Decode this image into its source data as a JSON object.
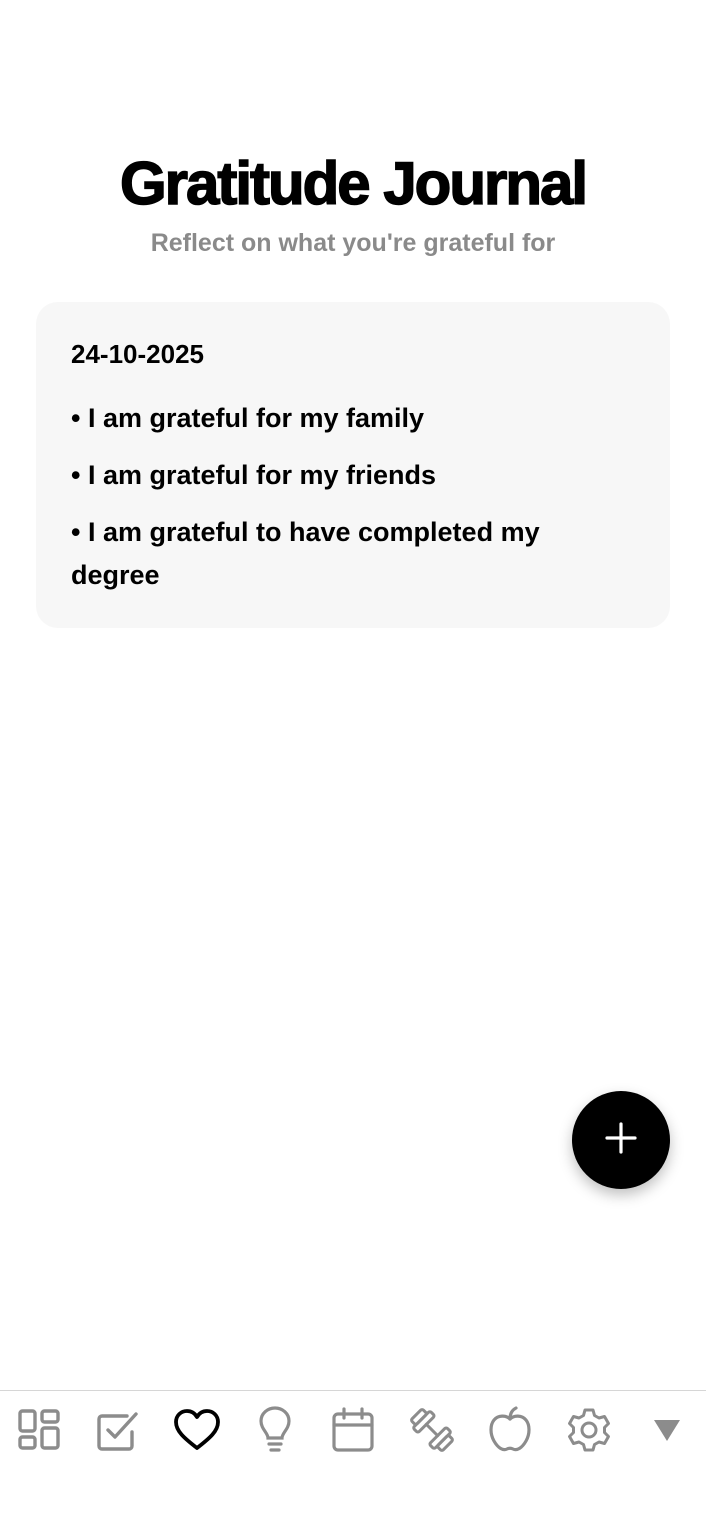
{
  "header": {
    "title": "Gratitude Journal",
    "subtitle": "Reflect on what you're grateful for"
  },
  "entries": [
    {
      "date": "24-10-2025",
      "items": [
        "I am grateful for my family",
        "I am grateful for my friends",
        "I am grateful to have completed my degree"
      ]
    }
  ],
  "fab": {
    "icon": "plus-icon"
  },
  "tabbar": {
    "active_tab": "gratitude",
    "tabs": [
      {
        "id": "dashboard",
        "icon": "dashboard-grid-icon",
        "active": false
      },
      {
        "id": "tasks",
        "icon": "checkbox-icon",
        "active": false
      },
      {
        "id": "gratitude",
        "icon": "heart-icon",
        "active": true
      },
      {
        "id": "ideas",
        "icon": "lightbulb-icon",
        "active": false
      },
      {
        "id": "calendar",
        "icon": "calendar-icon",
        "active": false
      },
      {
        "id": "fitness",
        "icon": "dumbbell-icon",
        "active": false
      },
      {
        "id": "nutrition",
        "icon": "apple-icon",
        "active": false
      },
      {
        "id": "settings",
        "icon": "gear-icon",
        "active": false
      },
      {
        "id": "more",
        "icon": "triangle-down-icon",
        "active": false
      }
    ]
  },
  "colors": {
    "background": "#ffffff",
    "card": "#f7f7f7",
    "subtitle": "#8a8a8a",
    "inactive_icon": "#8c8c8c",
    "active_icon": "#000000",
    "fab": "#000000"
  }
}
